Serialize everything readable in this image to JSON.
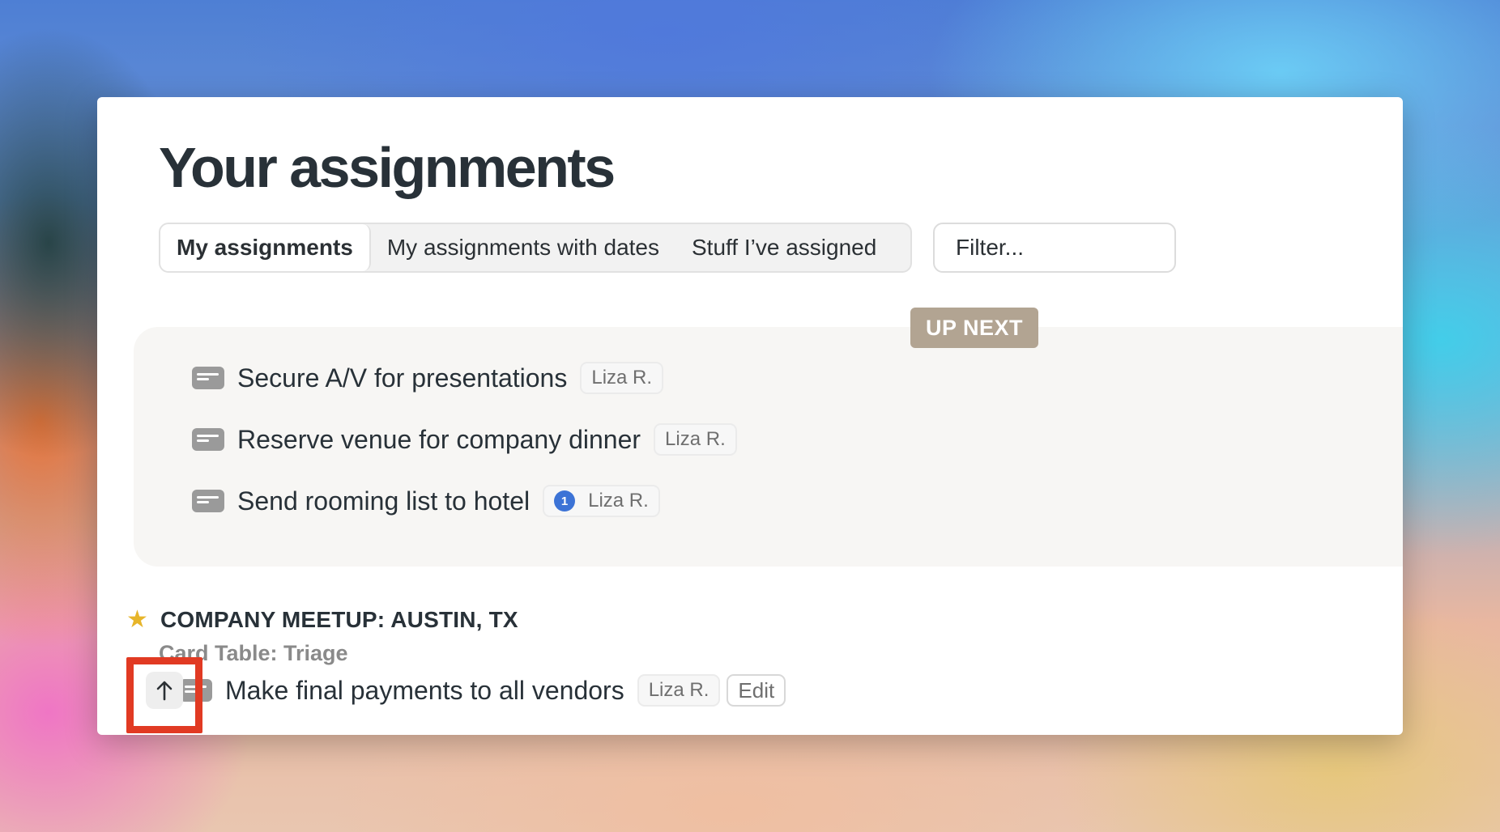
{
  "page": {
    "title": "Your assignments"
  },
  "tabs": [
    {
      "label": "My assignments",
      "active": true
    },
    {
      "label": "My assignments with dates",
      "active": false
    },
    {
      "label": "Stuff I’ve assigned",
      "active": false
    }
  ],
  "filter": {
    "placeholder": "Filter..."
  },
  "up_next": {
    "badge": "UP NEXT",
    "items": [
      {
        "title": "Secure A/V for presentations",
        "assignee": "Liza R."
      },
      {
        "title": "Reserve venue for company dinner",
        "assignee": "Liza R."
      },
      {
        "title": "Send rooming list to hotel",
        "assignee": "Liza R.",
        "count": "1"
      }
    ]
  },
  "project": {
    "name": "COMPANY MEETUP: AUSTIN, TX",
    "subtitle": "Card Table: Triage",
    "item": {
      "title": "Make final payments to all vendors",
      "assignee": "Liza R.",
      "edit_label": "Edit"
    }
  },
  "colors": {
    "badge_bg": "#b2a492",
    "star": "#e7b52a",
    "count_dot": "#3c73d6",
    "highlight": "#e13a23"
  },
  "icons": {
    "card": "card-icon",
    "star": "star-icon",
    "arrow_up": "arrow-up-icon"
  }
}
